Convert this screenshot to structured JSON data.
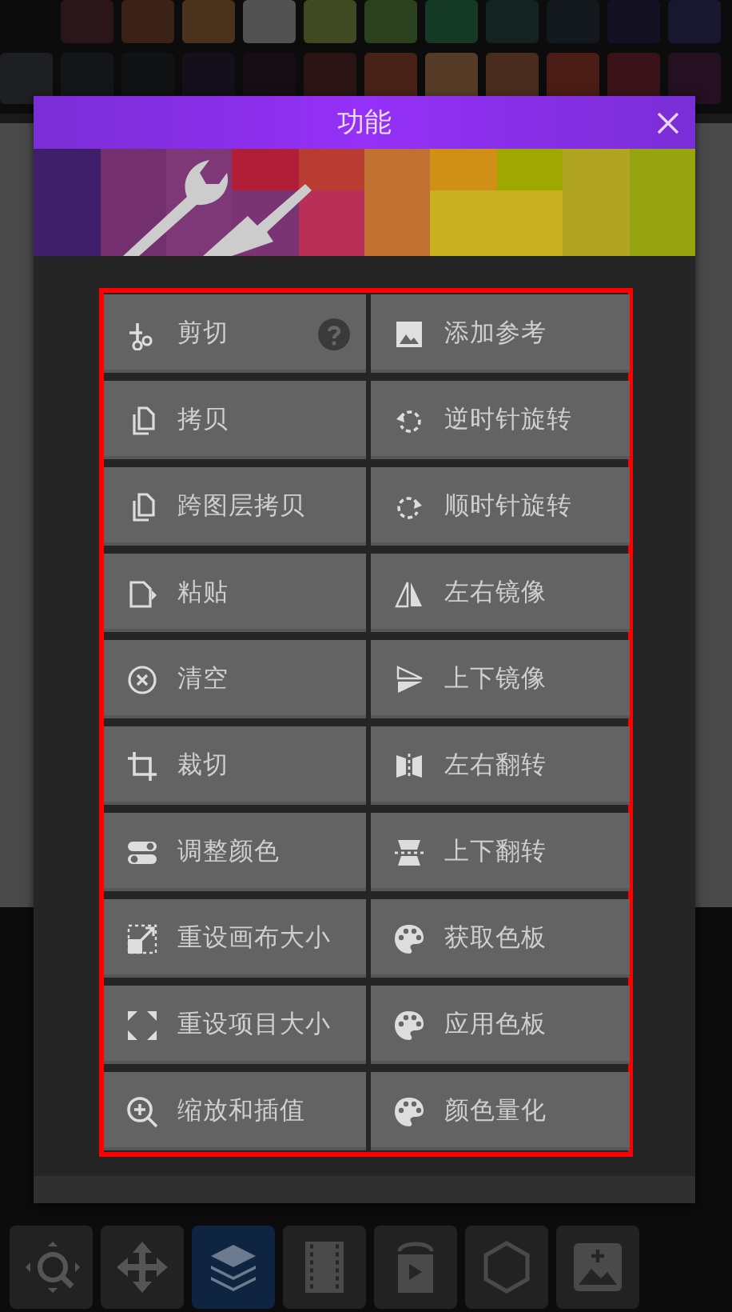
{
  "palette": {
    "rows": [
      {
        "swatches": [
          {
            "color": "#2a1518"
          },
          {
            "color": "#3a2218"
          },
          {
            "color": "#4a331c"
          },
          {
            "color": "#525252"
          },
          {
            "color": "#3f4a22"
          },
          {
            "color": "#2a401e"
          },
          {
            "color": "#143a26"
          },
          {
            "color": "#132322"
          },
          {
            "color": "#12181c"
          },
          {
            "color": "#141222"
          },
          {
            "color": "#171730"
          }
        ]
      },
      {
        "swatches": [
          {
            "color": "#1e1f22"
          },
          {
            "color": "#141518"
          },
          {
            "color": "#101214"
          },
          {
            "color": "#140f1a"
          },
          {
            "color": "#170d14"
          },
          {
            "color": "#2a1414"
          },
          {
            "color": "#482218"
          },
          {
            "color": "#563c26"
          },
          {
            "color": "#4a2c1e"
          },
          {
            "color": "#4a1c16"
          },
          {
            "color": "#3a1219"
          },
          {
            "color": "#241020"
          }
        ]
      }
    ]
  },
  "dialog": {
    "title": "功能",
    "items": [
      {
        "label": "剪切",
        "kind": "scissors",
        "help": true
      },
      {
        "label": "添加参考",
        "kind": "image",
        "help": false
      },
      {
        "label": "拷贝",
        "kind": "copy",
        "help": false
      },
      {
        "label": "逆时针旋转",
        "kind": "rotateleft",
        "help": false
      },
      {
        "label": "跨图层拷贝",
        "kind": "copy",
        "help": false
      },
      {
        "label": "顺时针旋转",
        "kind": "rotateright",
        "help": false
      },
      {
        "label": "粘贴",
        "kind": "paste",
        "help": false
      },
      {
        "label": "左右镜像",
        "kind": "mirrorh",
        "help": false
      },
      {
        "label": "清空",
        "kind": "clear",
        "help": false
      },
      {
        "label": "上下镜像",
        "kind": "mirrorv",
        "help": false
      },
      {
        "label": "裁切",
        "kind": "crop",
        "help": false
      },
      {
        "label": "左右翻转",
        "kind": "fliph",
        "help": false
      },
      {
        "label": "调整颜色",
        "kind": "sliders",
        "help": false
      },
      {
        "label": "上下翻转",
        "kind": "flipv",
        "help": false
      },
      {
        "label": "重设画布大小",
        "kind": "resize",
        "help": false
      },
      {
        "label": "获取色板",
        "kind": "palette",
        "help": false
      },
      {
        "label": "重设项目大小",
        "kind": "expand",
        "help": false
      },
      {
        "label": "应用色板",
        "kind": "palette",
        "help": false
      },
      {
        "label": "缩放和插值",
        "kind": "zoom",
        "help": false
      },
      {
        "label": "颜色量化",
        "kind": "palette",
        "help": false
      }
    ]
  },
  "toolbar": {
    "tools": [
      {
        "selected": false
      },
      {
        "selected": false
      },
      {
        "selected": true
      },
      {
        "selected": false
      },
      {
        "selected": false
      },
      {
        "selected": false
      },
      {
        "selected": false
      }
    ]
  }
}
